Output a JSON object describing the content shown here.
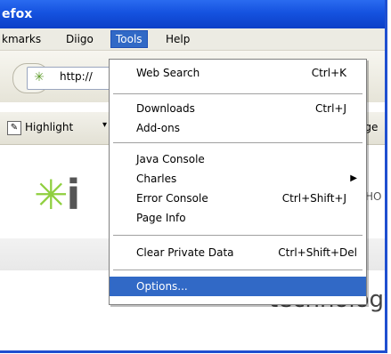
{
  "title": "efox",
  "menubar": {
    "items": [
      "kmarks",
      "Diigo",
      "Tools",
      "Help"
    ]
  },
  "navbar": {
    "url_text": "http://"
  },
  "toolbar": {
    "highlight_label": "Highlight",
    "arrow": "▾",
    "right_label": "age"
  },
  "page": {
    "logo_text": "i",
    "logo_mark": "✳",
    "side_text": "HO",
    "bottom_text": "technology's"
  },
  "tools_menu": {
    "items": [
      {
        "label": "Web Search",
        "shortcut": "Ctrl+K"
      },
      {
        "label": "Downloads",
        "shortcut": "Ctrl+J"
      },
      {
        "label": "Add-ons",
        "shortcut": ""
      },
      {
        "label": "Java Console",
        "shortcut": ""
      },
      {
        "label": "Charles",
        "shortcut": ""
      },
      {
        "label": "Error Console",
        "shortcut": "Ctrl+Shift+J"
      },
      {
        "label": "Page Info",
        "shortcut": ""
      },
      {
        "label": "Clear Private Data",
        "shortcut": "Ctrl+Shift+Del"
      },
      {
        "label": "Options...",
        "shortcut": ""
      }
    ],
    "selected_index": 8
  }
}
